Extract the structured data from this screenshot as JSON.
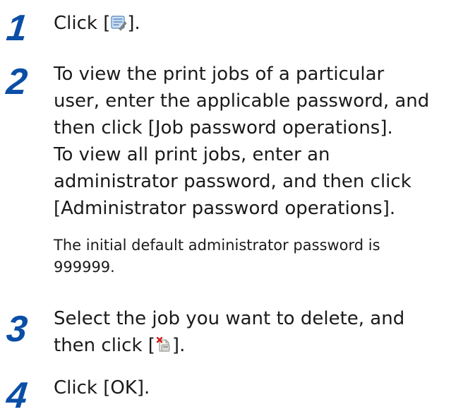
{
  "steps": [
    {
      "number": "1",
      "before_icon": "Click [",
      "icon": "job-list-icon",
      "after_icon": "]."
    },
    {
      "number": "2",
      "lines": [
        "To view the print jobs of a particular",
        "user, enter the applicable password, and",
        "then click [Job password operations].",
        "To view all print jobs, enter an",
        "administrator password, and then click",
        "[Administrator password operations]."
      ],
      "note_lines": [
        "The initial default administrator password is",
        "999999."
      ]
    },
    {
      "number": "3",
      "line1": "Select the job you want to delete, and",
      "before_icon": "then click [",
      "icon": "delete-job-icon",
      "after_icon": "]."
    },
    {
      "number": "4",
      "text": "Click [OK]."
    }
  ],
  "colors": {
    "step_number": "#0a4ea6",
    "text": "#1a1a1a"
  }
}
